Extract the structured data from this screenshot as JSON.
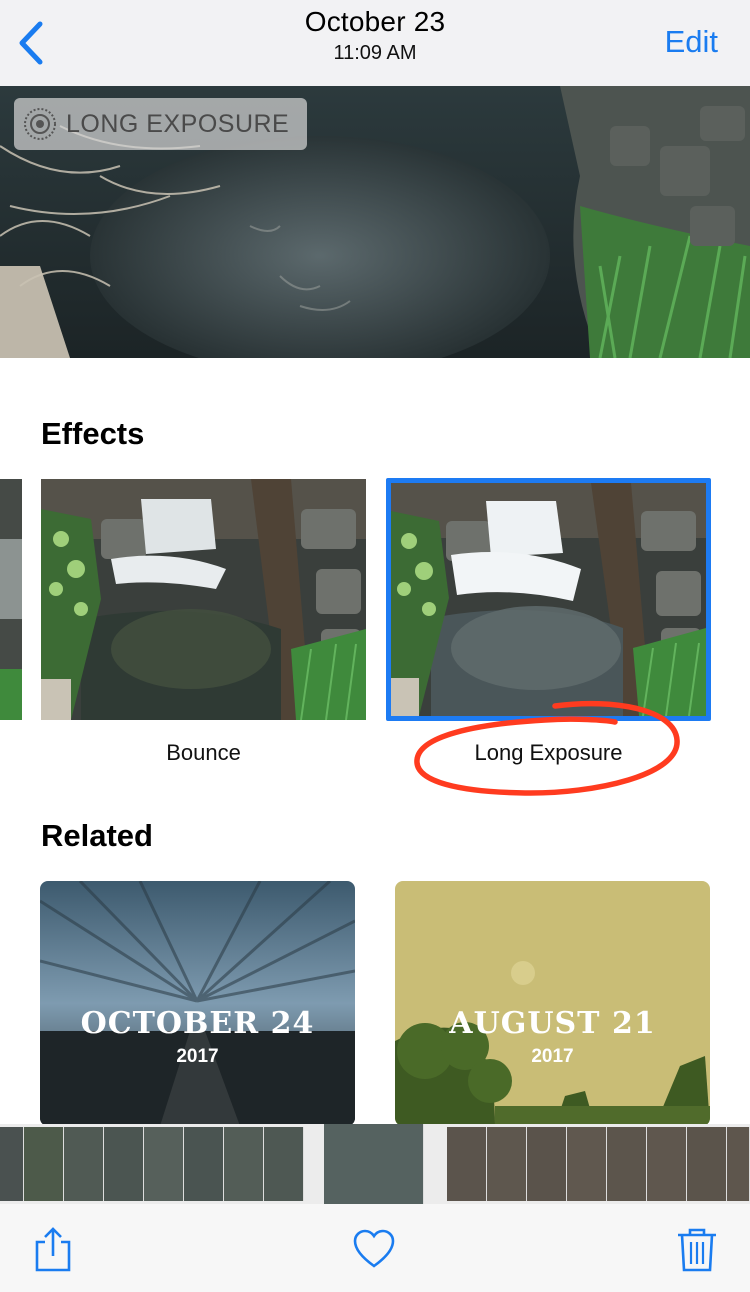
{
  "header": {
    "back_icon": "chevron-left-icon",
    "title": "October 23",
    "subtitle": "11:09 AM",
    "edit_label": "Edit",
    "accent": "#1a7cf0"
  },
  "hero": {
    "badge_icon": "live-photo-icon",
    "badge_text": "LONG EXPOSURE"
  },
  "effects": {
    "title": "Effects",
    "items": [
      {
        "label": "Bounce",
        "selected": false
      },
      {
        "label": "Long Exposure",
        "selected": true
      }
    ],
    "selection_color": "#1d7bf3",
    "annotation_color": "#ff3b1f"
  },
  "related": {
    "title": "Related",
    "memories": [
      {
        "title": "OCTOBER 24",
        "year": "2017"
      },
      {
        "title": "AUGUST 21",
        "year": "2017"
      }
    ]
  },
  "toolbar": {
    "share_icon": "share-icon",
    "favorite_icon": "heart-icon",
    "delete_icon": "trash-icon"
  }
}
